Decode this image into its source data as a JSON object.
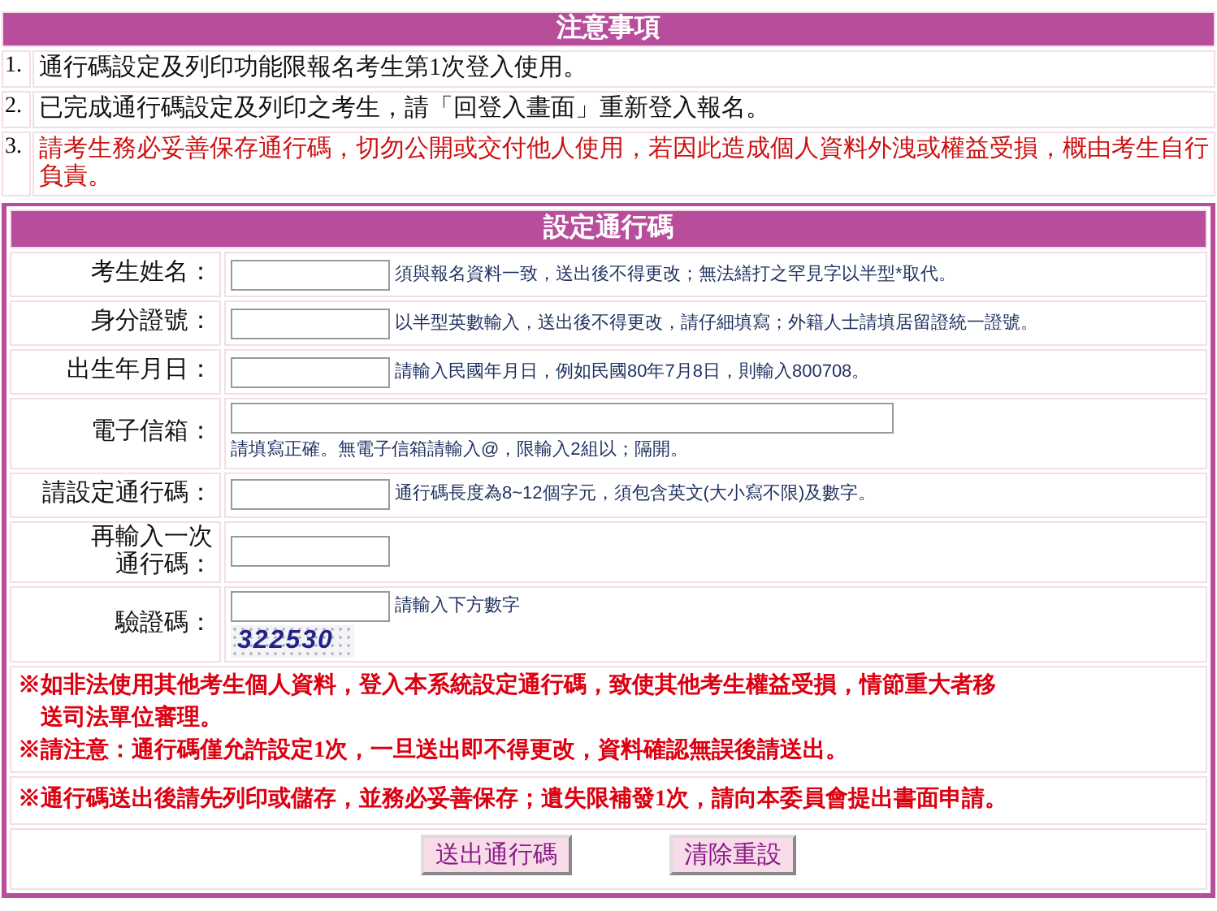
{
  "notice": {
    "title": "注意事項",
    "items": [
      {
        "number": "1.",
        "text": "通行碼設定及列印功能限報名考生第1次登入使用。",
        "kind": "normal"
      },
      {
        "number": "2.",
        "text": "已完成通行碼設定及列印之考生，請「回登入畫面」重新登入報名。",
        "kind": "normal"
      },
      {
        "number": "3.",
        "text": "請考生務必妥善保存通行碼，切勿公開或交付他人使用，若因此造成個人資料外洩或權益受損，概由考生自行負責。",
        "kind": "warning"
      }
    ]
  },
  "form": {
    "title": "設定通行碼",
    "fields": [
      {
        "label": [
          "考生姓名："
        ],
        "kind": "inline",
        "hint": "須與報名資料一致，送出後不得更改；無法繕打之罕見字以半型*取代。"
      },
      {
        "label": [
          "身分證號："
        ],
        "kind": "inline",
        "hint": "以半型英數輸入，送出後不得更改，請仔細填寫；外籍人士請填居留證統一證號。"
      },
      {
        "label": [
          "出生年月日："
        ],
        "kind": "inline",
        "hint": "請輸入民國年月日，例如民國80年7月8日，則輸入800708。"
      },
      {
        "label": [
          "電子信箱："
        ],
        "kind": "stacked",
        "hint": "請填寫正確。無電子信箱請輸入@，限輸入2組以；隔開。"
      },
      {
        "label": [
          "請設定通行碼："
        ],
        "kind": "inline",
        "hint": "通行碼長度為8~12個字元，須包含英文(大小寫不限)及數字。"
      },
      {
        "label": [
          "再輸入一次",
          "通行碼："
        ],
        "kind": "inline"
      },
      {
        "label": [
          "驗證碼："
        ],
        "kind": "captcha",
        "hint": "請輸入下方數字",
        "captcha": "322530"
      }
    ],
    "warnings": [
      "※如非法使用其他考生個人資料，登入本系統設定通行碼，致使其他考生權益受損，情節重大者移送司法單位審理。",
      "※請注意：通行碼僅允許設定1次，一旦送出即不得更改，資料確認無誤後請送出。"
    ],
    "note": "※通行碼送出後請先列印或儲存，並務必妥善保存；遺失限補發1次，請向本委員會提出書面申請。",
    "buttons": [
      "送出通行碼",
      "清除重設"
    ]
  }
}
